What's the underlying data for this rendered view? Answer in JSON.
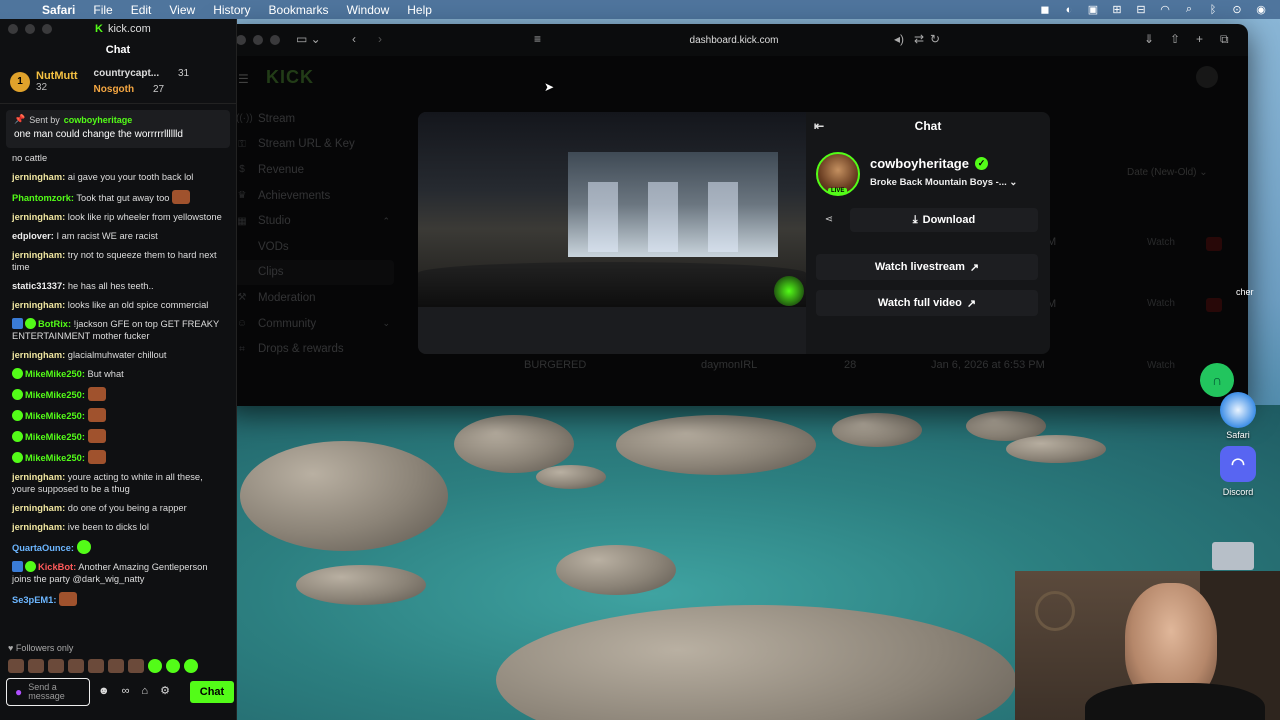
{
  "menubar": {
    "app": "Safari",
    "items": [
      "File",
      "Edit",
      "View",
      "History",
      "Bookmarks",
      "Window",
      "Help"
    ]
  },
  "popout": {
    "url": "kick.com",
    "title": "Chat",
    "leaderboard": {
      "first_rank": "1",
      "first_name": "NutMutt",
      "first_count": "32",
      "second_name": "countrycapt...",
      "second_count": "31",
      "third_name": "Nosgoth",
      "third_count": "27"
    },
    "pinned": {
      "sent_by_label": "Sent by",
      "sender": "cowboyheritage",
      "message": "one man could change the worrrrrlllllld"
    },
    "messages": [
      {
        "user": "",
        "text": "no cattle"
      },
      {
        "user": "jerningham:",
        "text": " ai gave you your tooth back lol"
      },
      {
        "user": "Phantomzork:",
        "text": " Took that gut away too"
      },
      {
        "user": "jerningham:",
        "text": " look like rip wheeler from yellowstone"
      },
      {
        "user": "edplover:",
        "text": " I am racist WE are racist"
      },
      {
        "user": "jerningham:",
        "text": " try not to squeeze them to hard next time"
      },
      {
        "user": "static31337:",
        "text": " he has all hes teeth.."
      },
      {
        "user": "jerningham:",
        "text": " looks like an old spice commercial"
      },
      {
        "user": "BotRix:",
        "text": " !jackson GFE on top GET FREAKY ENTERTAINMENT mother fucker"
      },
      {
        "user": "jerningham:",
        "text": " glacialmuhwater chillout"
      },
      {
        "user": "MikeMike250:",
        "text": " But what"
      },
      {
        "user": "MikeMike250:",
        "text": ""
      },
      {
        "user": "MikeMike250:",
        "text": ""
      },
      {
        "user": "MikeMike250:",
        "text": ""
      },
      {
        "user": "MikeMike250:",
        "text": ""
      },
      {
        "user": "jerningham:",
        "text": " youre acting to white in all these, youre supposed to be a thug"
      },
      {
        "user": "jerningham:",
        "text": " do one of you being a rapper"
      },
      {
        "user": "jerningham:",
        "text": " ive been to dicks lol"
      },
      {
        "user": "QuartaOunce:",
        "text": ""
      },
      {
        "user": "KickBot:",
        "text": " Another Amazing Gentleperson joins the party @dark_wig_natty"
      },
      {
        "user": "Se3pEM1:",
        "text": ""
      }
    ],
    "followers_only": "Followers only",
    "send_placeholder": "Send a message",
    "chat_button": "Chat"
  },
  "browser": {
    "address": "dashboard.kick.com"
  },
  "dashboard": {
    "logo": "KICK",
    "nav": [
      {
        "label": "Stream",
        "icon": "stream-icon"
      },
      {
        "label": "Stream URL & Key",
        "icon": "key-icon"
      },
      {
        "label": "Revenue",
        "icon": "dollar-icon"
      },
      {
        "label": "Achievements",
        "icon": "trophy-icon"
      },
      {
        "label": "Studio",
        "icon": "studio-icon"
      },
      {
        "label": "VODs",
        "icon": ""
      },
      {
        "label": "Clips",
        "icon": ""
      },
      {
        "label": "Moderation",
        "icon": "wrench-icon"
      },
      {
        "label": "Community",
        "icon": "community-icon"
      },
      {
        "label": "Drops & rewards",
        "icon": "gift-icon"
      }
    ],
    "date_filter": "Date (New-Old)",
    "watch_label": "Watch",
    "last_row": {
      "title": "BURGERED",
      "creator": "daymonIRL",
      "views": "28",
      "date": "Jan 6, 2026 at 6:53 PM"
    },
    "row_fragments": [
      "M",
      "M"
    ]
  },
  "modal": {
    "panel_title": "Chat",
    "streamer": "cowboyheritage",
    "live_badge": "LIVE",
    "stream_title": "Broke Back Mountain Boys -...",
    "download": "Download",
    "watch_livestream": "Watch livestream",
    "watch_full_video": "Watch full video"
  },
  "dock": {
    "safari": "Safari",
    "discord": "Discord",
    "other_label": "cher"
  },
  "colors": {
    "kick_green": "#53fc18",
    "panel_bg": "#151618"
  }
}
